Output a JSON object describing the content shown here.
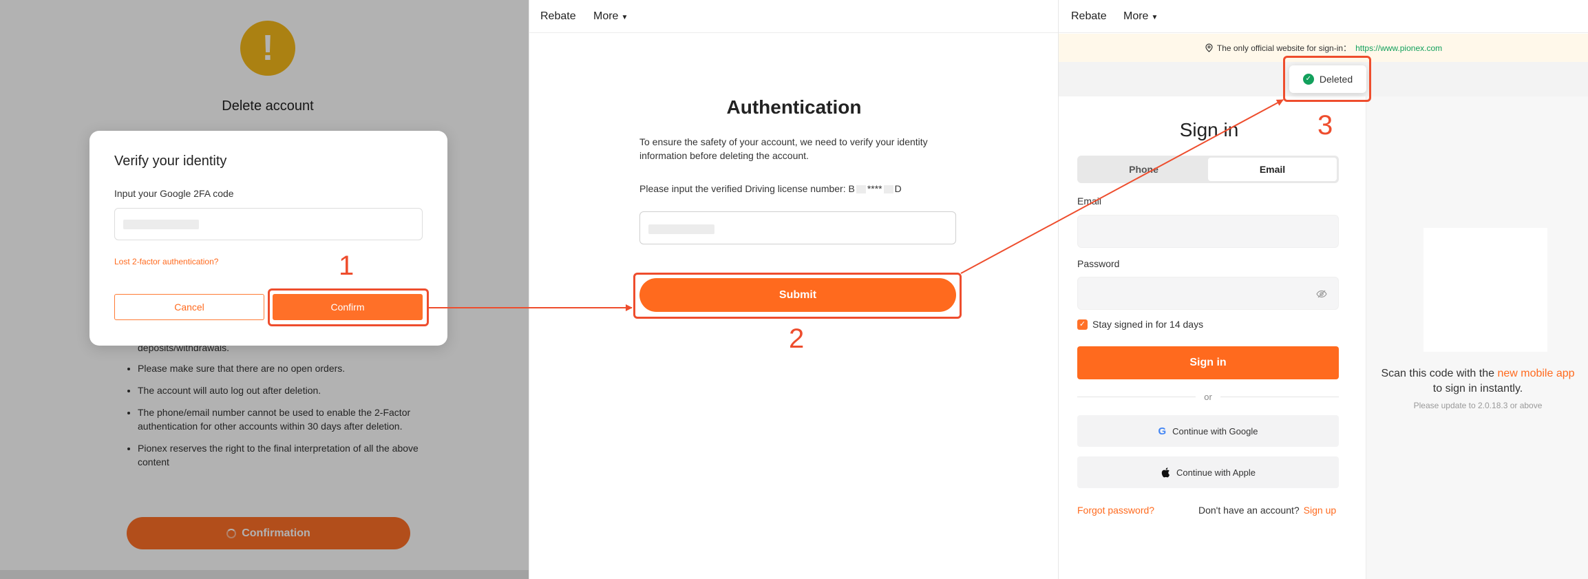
{
  "panel1": {
    "title": "Delete account",
    "notes_first": "deposits/withdrawals.",
    "notes": [
      "Please make sure that there are no open orders.",
      "The account will auto log out after deletion.",
      "The phone/email number cannot be used to enable the 2-Factor authentication for other accounts within 30 days after deletion.",
      "Pionex reserves the right to the final interpretation of all the above content"
    ],
    "confirmation_label": "Confirmation",
    "modal": {
      "title": "Verify your identity",
      "input_label": "Input your Google 2FA code",
      "lost_link": "Lost 2-factor authentication?",
      "cancel": "Cancel",
      "confirm": "Confirm"
    }
  },
  "nav": {
    "rebate": "Rebate",
    "more": "More"
  },
  "panel2": {
    "title": "Authentication",
    "description": "To ensure the safety of your account, we need to verify your identity information before deleting the account.",
    "label_prefix": "Please input the verified Driving license number: B",
    "label_mid": "****",
    "label_suffix": "D",
    "submit": "Submit"
  },
  "panel3": {
    "notice_text": "The only official website for sign-in：",
    "notice_url": "https://www.pionex.com",
    "toast": "Deleted",
    "signin_title": "Sign in",
    "tabs": [
      "Phone",
      "Email"
    ],
    "email_label": "Email",
    "password_label": "Password",
    "stay_label": "Stay signed in for 14 days",
    "signin_button": "Sign in",
    "or": "or",
    "google": "Continue with Google",
    "apple": "Continue with Apple",
    "forgot": "Forgot password?",
    "no_account": "Don't have an account?",
    "signup": "Sign up",
    "qr_text_prefix": "Scan this code with the ",
    "qr_link": "new mobile app",
    "qr_text_line2": "to sign in instantly.",
    "qr_sub": "Please update to 2.0.18.3 or above"
  },
  "annotations": {
    "step1": "1",
    "step2": "2",
    "step3": "3"
  },
  "colors": {
    "accent": "#ff6a1e",
    "annotation": "#ee4d2d",
    "success": "#12a05c"
  }
}
